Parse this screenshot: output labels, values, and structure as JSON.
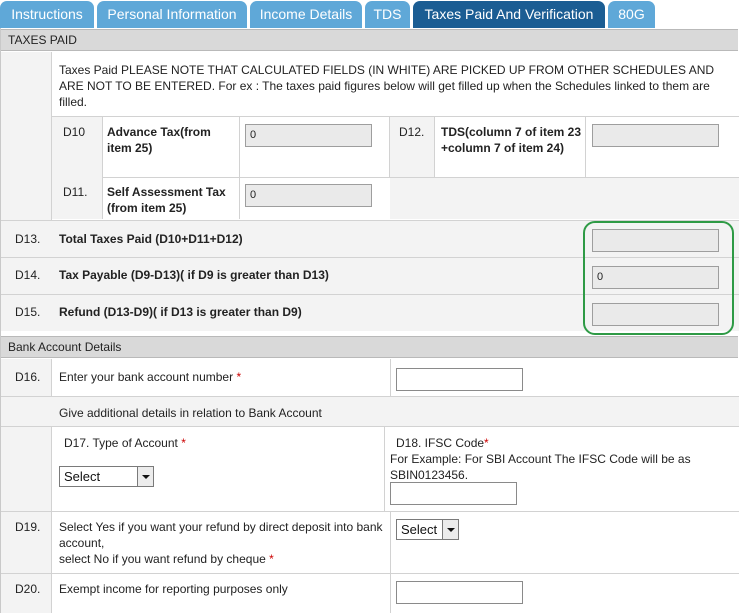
{
  "tabs": [
    {
      "label": "Instructions"
    },
    {
      "label": "Personal Information"
    },
    {
      "label": "Income Details"
    },
    {
      "label": "TDS"
    },
    {
      "label": "Taxes Paid And Verification"
    },
    {
      "label": "80G"
    }
  ],
  "active_tab": "Taxes Paid And Verification",
  "taxes_paid": {
    "header": "TAXES PAID",
    "note": "Taxes Paid PLEASE NOTE THAT CALCULATED FIELDS (IN WHITE) ARE PICKED UP FROM OTHER SCHEDULES AND ARE NOT TO BE ENTERED. For ex : The taxes paid figures below will get filled up when the Schedules linked to them are filled.",
    "d10": {
      "code": "D10",
      "label": "Advance Tax(from item 25)",
      "value": "0"
    },
    "d12": {
      "code": "D12.",
      "label": "TDS(column 7 of item 23 +column 7 of item 24)",
      "value": ""
    },
    "d11": {
      "code": "D11.",
      "label": "Self Assessment Tax (from item 25)",
      "value": "0"
    },
    "d13": {
      "code": "D13.",
      "label": "Total Taxes Paid (D10+D11+D12)",
      "value": ""
    },
    "d14": {
      "code": "D14.",
      "label": "Tax Payable (D9-D13)( if D9 is greater than D13)",
      "value": "0"
    },
    "d15": {
      "code": "D15.",
      "label": "Refund (D13-D9)( if D13 is greater than D9)",
      "value": ""
    }
  },
  "bank": {
    "header": "Bank Account Details",
    "d16": {
      "code": "D16.",
      "label": "Enter your bank account number",
      "required": "*",
      "value": ""
    },
    "additional": "Give additional details in relation to Bank Account",
    "d17": {
      "label": "D17. Type of Account",
      "required": "*",
      "selected": "Select"
    },
    "d18": {
      "label": "D18. IFSC Code",
      "required": "*",
      "example": "For Example: For SBI Account The IFSC Code will be as SBIN0123456.",
      "value": ""
    },
    "d19": {
      "code": "D19.",
      "label_line1": "Select Yes if you want your refund by direct deposit into bank account,",
      "label_line2": "select No if you want refund by cheque",
      "required": "*",
      "selected": "Select"
    },
    "d20": {
      "code": "D20.",
      "label": "Exempt income for reporting purposes only",
      "value": ""
    }
  },
  "colors": {
    "tab": "#5fa8d8",
    "tab_active": "#1b5d93",
    "highlight": "#2e9a45"
  }
}
